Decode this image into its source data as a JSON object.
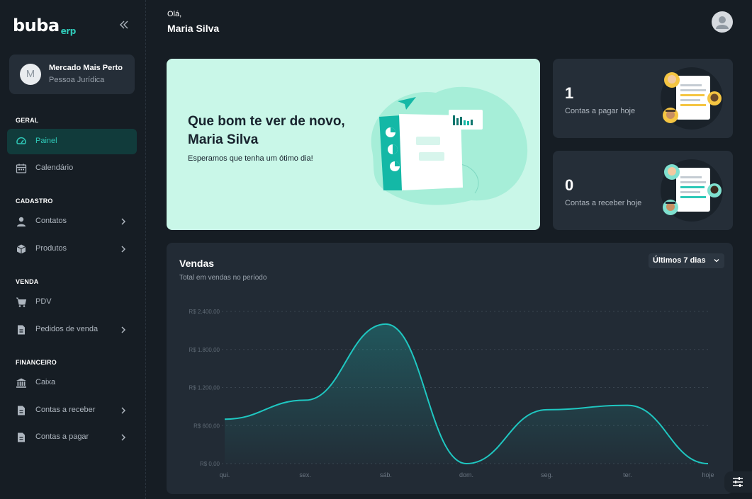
{
  "brand": {
    "name": "buba",
    "suffix": "erp",
    "accent": "#2fc9b8"
  },
  "sidebar": {
    "company": {
      "initial": "M",
      "name": "Mercado Mais Perto",
      "type": "Pessoa Jurídica"
    },
    "sections": {
      "geral": "GERAL",
      "cadastro": "CADASTRO",
      "venda": "VENDA",
      "financeiro": "FINANCEIRO"
    },
    "items": {
      "painel": {
        "label": "Painel",
        "icon": "gauge-icon",
        "active": true
      },
      "calendario": {
        "label": "Calendário",
        "icon": "calendar-icon"
      },
      "contatos": {
        "label": "Contatos",
        "icon": "person-icon"
      },
      "produtos": {
        "label": "Produtos",
        "icon": "box-icon"
      },
      "pdv": {
        "label": "PDV",
        "icon": "cart-icon"
      },
      "pedidos": {
        "label": "Pedidos de venda",
        "icon": "document-icon"
      },
      "caixa": {
        "label": "Caixa",
        "icon": "bank-icon"
      },
      "receber": {
        "label": "Contas a receber",
        "icon": "document-icon"
      },
      "pagar": {
        "label": "Contas a pagar",
        "icon": "document-icon"
      }
    }
  },
  "header": {
    "greeting": "Olá,",
    "user_name": "Maria Silva"
  },
  "welcome": {
    "title": "Que bom te ver de novo, Maria Silva",
    "subtitle": "Esperamos que tenha um ótimo dia!"
  },
  "stats": {
    "pagar": {
      "value": "1",
      "label": "Contas a pagar hoje"
    },
    "receber": {
      "value": "0",
      "label": "Contas a receber hoje"
    }
  },
  "sales": {
    "title": "Vendas",
    "subtitle": "Total em vendas no período",
    "period": "Últimos 7 dias"
  },
  "chart_data": {
    "type": "area",
    "categories": [
      "qui.",
      "sex.",
      "sáb.",
      "dom.",
      "seg.",
      "ter.",
      "hoje"
    ],
    "y_tick_labels": [
      "R$ 0,00",
      "R$ 600,00",
      "R$ 1.200,00",
      "R$ 1.800,00",
      "R$ 2.400,00"
    ],
    "y_ticks": [
      0,
      600,
      1200,
      1800,
      2400
    ],
    "values": [
      700,
      1000,
      2200,
      0,
      850,
      920,
      0
    ],
    "ylim": [
      0,
      2400
    ],
    "line_color": "#1fc7c1",
    "grid": true
  }
}
